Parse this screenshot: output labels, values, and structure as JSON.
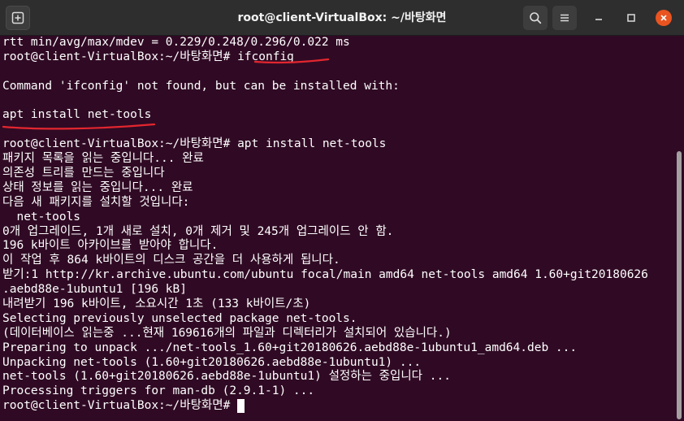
{
  "window": {
    "title": "root@client-VirtualBox: ~/바탕화면"
  },
  "colors": {
    "terminal_bg": "#300a24",
    "titlebar_bg": "#2e2e2e",
    "close_button": "#e95420",
    "annotation_underline": "#e3262f"
  },
  "icons": {
    "new_tab": "new-tab-icon",
    "search": "search-icon",
    "menu": "hamburger-menu-icon",
    "minimize": "minimize-icon",
    "maximize": "maximize-icon",
    "close": "close-icon"
  },
  "terminal": {
    "lines": [
      {
        "text": "rtt min/avg/max/mdev = 0.229/0.248/0.296/0.022 ms"
      },
      {
        "prompt": "root@client-VirtualBox:~/바탕화면# ",
        "command": "ifconfig"
      },
      {
        "text": ""
      },
      {
        "text": "Command 'ifconfig' not found, but can be installed with:"
      },
      {
        "text": ""
      },
      {
        "text": "apt install net-tools"
      },
      {
        "text": ""
      },
      {
        "prompt": "root@client-VirtualBox:~/바탕화면# ",
        "command": "apt install net-tools"
      },
      {
        "text": "패키지 목록을 읽는 중입니다... 완료"
      },
      {
        "text": "의존성 트리를 만드는 중입니다"
      },
      {
        "text": "상태 정보를 읽는 중입니다... 완료"
      },
      {
        "text": "다음 새 패키지를 설치할 것입니다:"
      },
      {
        "text": "  net-tools"
      },
      {
        "text": "0개 업그레이드, 1개 새로 설치, 0개 제거 및 245개 업그레이드 안 함."
      },
      {
        "text": "196 k바이트 아카이브를 받아야 합니다."
      },
      {
        "text": "이 작업 후 864 k바이트의 디스크 공간을 더 사용하게 됩니다."
      },
      {
        "text": "받기:1 http://kr.archive.ubuntu.com/ubuntu focal/main amd64 net-tools amd64 1.60+git20180626"
      },
      {
        "text": ".aebd88e-1ubuntu1 [196 kB]"
      },
      {
        "text": "내려받기 196 k바이트, 소요시간 1초 (133 k바이트/초)"
      },
      {
        "text": "Selecting previously unselected package net-tools."
      },
      {
        "text": "(데이터베이스 읽는중 ...현재 169616개의 파일과 디렉터리가 설치되어 있습니다.)"
      },
      {
        "text": "Preparing to unpack .../net-tools_1.60+git20180626.aebd88e-1ubuntu1_amd64.deb ..."
      },
      {
        "text": "Unpacking net-tools (1.60+git20180626.aebd88e-1ubuntu1) ..."
      },
      {
        "text": "net-tools (1.60+git20180626.aebd88e-1ubuntu1) 설정하는 중입니다 ..."
      },
      {
        "text": "Processing triggers for man-db (2.9.1-1) ..."
      },
      {
        "prompt": "root@client-VirtualBox:~/바탕화면# ",
        "command": "",
        "cursor": true
      }
    ]
  }
}
